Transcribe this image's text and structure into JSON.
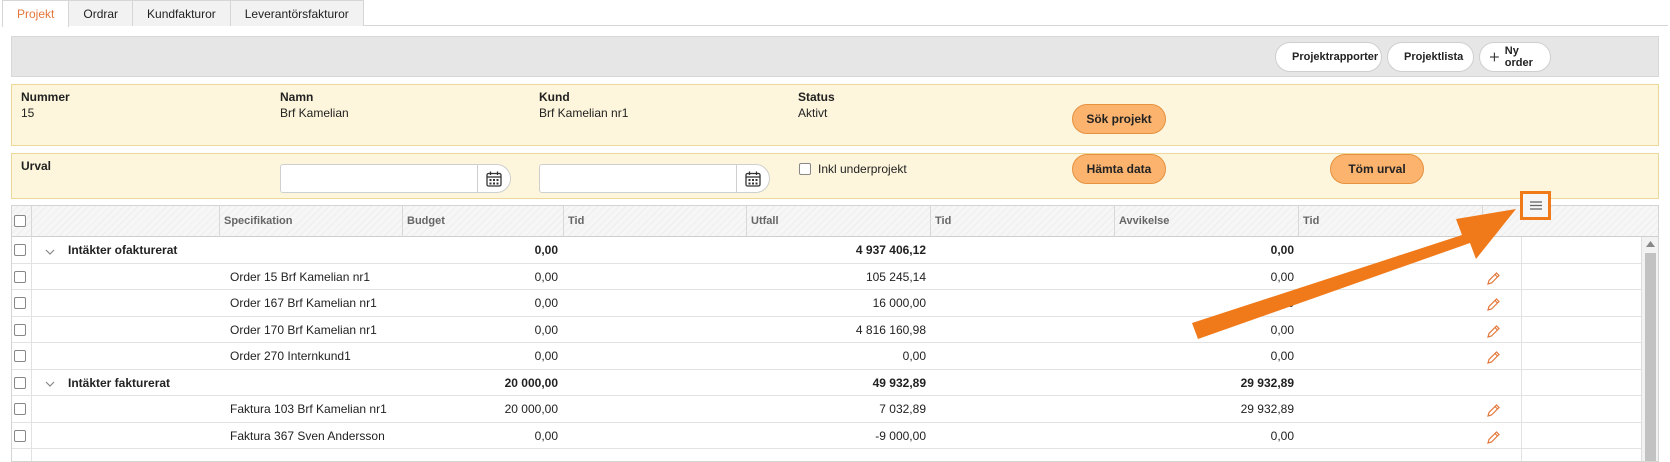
{
  "tabs": [
    "Projekt",
    "Ordrar",
    "Kundfakturor",
    "Leverantörsfakturor"
  ],
  "toolbar": {
    "project_reports": "Projektrapporter",
    "project_list": "Projektlista",
    "new_order": "Ny order"
  },
  "info": {
    "number_label": "Nummer",
    "number_value": "15",
    "name_label": "Namn",
    "name_value": "Brf Kamelian",
    "customer_label": "Kund",
    "customer_value": "Brf Kamelian nr1",
    "status_label": "Status",
    "status_value": "Aktivt",
    "search_button": "Sök projekt"
  },
  "urval": {
    "label": "Urval",
    "date_from": "",
    "date_to": "",
    "include_subprojects": "Inkl underprojekt",
    "fetch_button": "Hämta data",
    "clear_button": "Töm urval"
  },
  "grid": {
    "headers": [
      "Specifikation",
      "Budget",
      "Tid",
      "Utfall",
      "Tid",
      "Avvikelse",
      "Tid"
    ],
    "rows": [
      {
        "type": "group",
        "spec": "Intäkter ofakturerat",
        "budget": "0,00",
        "utfall": "4 937 406,12",
        "avvikelse": "0,00"
      },
      {
        "type": "item",
        "spec": "Order 15 Brf Kamelian nr1",
        "budget": "0,00",
        "utfall": "105 245,14",
        "avvikelse": "0,00"
      },
      {
        "type": "item",
        "spec": "Order 167 Brf Kamelian nr1",
        "budget": "0,00",
        "utfall": "16 000,00",
        "avvikelse": "0,00"
      },
      {
        "type": "item",
        "spec": "Order 170 Brf Kamelian nr1",
        "budget": "0,00",
        "utfall": "4 816 160,98",
        "avvikelse": "0,00"
      },
      {
        "type": "item",
        "spec": "Order 270 Internkund1",
        "budget": "0,00",
        "utfall": "0,00",
        "avvikelse": "0,00"
      },
      {
        "type": "group",
        "spec": "Intäkter fakturerat",
        "budget": "20 000,00",
        "utfall": "49 932,89",
        "avvikelse": "29 932,89"
      },
      {
        "type": "item",
        "spec": "Faktura 103 Brf Kamelian nr1",
        "budget": "20 000,00",
        "utfall": "7 032,89",
        "avvikelse": "29 932,89"
      },
      {
        "type": "item",
        "spec": "Faktura 367 Sven Andersson",
        "budget": "0,00",
        "utfall": "-9 000,00",
        "avvikelse": "0,00"
      }
    ]
  },
  "colors": {
    "accent": "#e4773a",
    "orange_button": "#fbb36e",
    "info_background": "#fdf6dc",
    "highlight": "#f07a1a"
  }
}
